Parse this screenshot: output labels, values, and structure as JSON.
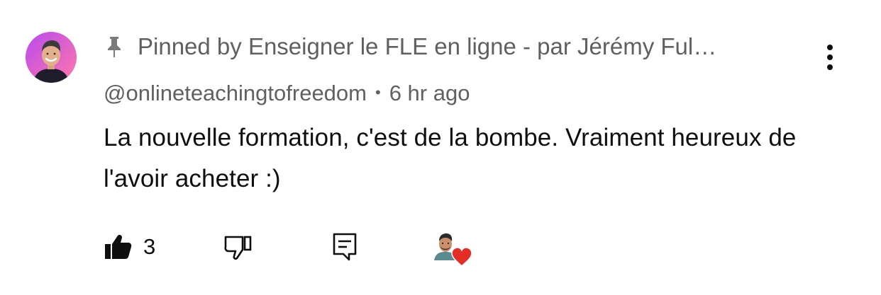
{
  "comment": {
    "pinned_label": "Pinned by Enseigner le FLE en ligne - par Jérémy Ful…",
    "author_handle": "@onlineteachingtofreedom",
    "separator": "•",
    "timestamp": "6 hr ago",
    "text": "La nouvelle formation, c'est de la bombe. Vraiment heureux de l'avoir acheter :)",
    "like_count": "3"
  },
  "icons": {
    "pin": "pin-icon",
    "more": "more-vertical-icon",
    "like": "thumbs-up-filled-icon",
    "dislike": "thumbs-down-outline-icon",
    "reply": "reply-comment-icon",
    "creator_heart": "heart-icon"
  },
  "colors": {
    "secondary_text": "#606060",
    "primary_text": "#0f0f0f",
    "heart": "#e52d27",
    "avatar_gradient_start": "#c045e8",
    "avatar_gradient_end": "#ff6fa0"
  }
}
